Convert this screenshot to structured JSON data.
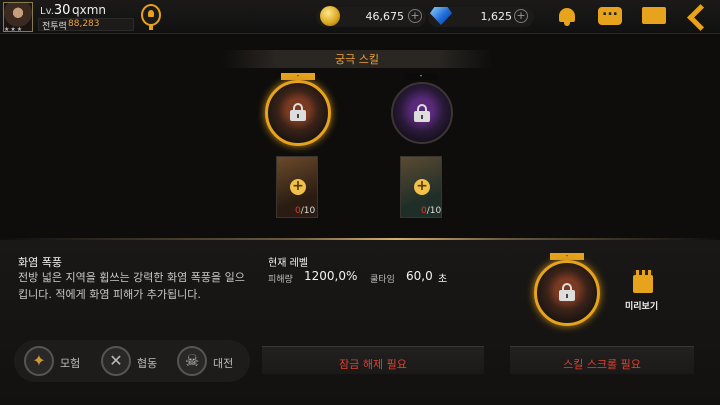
{
  "player": {
    "level_prefix": "Lv.",
    "level": "30",
    "name": "qxmn",
    "power_label": "전투력",
    "power_value": "88,283"
  },
  "resources": {
    "gold": "46,675",
    "gems": "1,625"
  },
  "icons": {
    "hint": "lightbulb-icon",
    "bell": "bell-icon",
    "chat": "chat-icon",
    "mail": "mail-icon",
    "back": "back-arrow-icon"
  },
  "ultimate": {
    "title": "궁극 스킬",
    "slots": [
      {
        "tag": "-",
        "scroll_current": "0",
        "scroll_total": "/10",
        "selected": true
      },
      {
        "tag": "-",
        "scroll_current": "0",
        "scroll_total": "/10",
        "selected": false
      }
    ]
  },
  "detail": {
    "name": "화염 폭풍",
    "description": "전방 넓은 지역을 휩쓰는 강력한 화염 폭풍을 일으킵니다. 적에게 화염 피해가 추가됩니다.",
    "current_level_label": "현재 레벨",
    "damage_label": "피해량",
    "damage_value": "1200,0%",
    "cooldown_label": "쿨타임",
    "cooldown_value": "60,0",
    "cooldown_unit": "초",
    "tag": "-",
    "preview_label": "미리보기",
    "unlock_button": "잠금 해제 필요",
    "scroll_button": "스킬 스크롤 필요"
  },
  "modes": [
    {
      "label": "모험",
      "icon": "compass-icon"
    },
    {
      "label": "협동",
      "icon": "crossed-swords-icon"
    },
    {
      "label": "대전",
      "icon": "skull-icon"
    }
  ],
  "colors": {
    "accent": "#f0a33a",
    "warning": "#e3412e",
    "icon_gold": "#e8a31c"
  }
}
